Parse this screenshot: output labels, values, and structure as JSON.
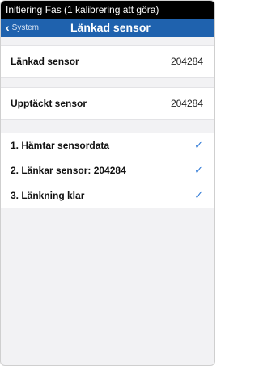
{
  "status_bar": {
    "text": "Initiering Fas (1 kalibrering att göra)"
  },
  "nav": {
    "back_label": "System",
    "title": "Länkad sensor"
  },
  "linked_sensor": {
    "label": "Länkad sensor",
    "value": "204284"
  },
  "detected_sensor": {
    "label": "Upptäckt sensor",
    "value": "204284"
  },
  "steps": [
    {
      "label": "1. Hämtar sensordata",
      "status_icon": "checkmark-icon"
    },
    {
      "label": "2. Länkar sensor: 204284",
      "status_icon": "checkmark-icon"
    },
    {
      "label": "3. Länkning klar",
      "status_icon": "checkmark-icon"
    }
  ],
  "colors": {
    "nav_bar": "#1f62ae",
    "status_bar": "#000000",
    "checkmark": "#2f79d6",
    "background": "#f2f2f4"
  }
}
